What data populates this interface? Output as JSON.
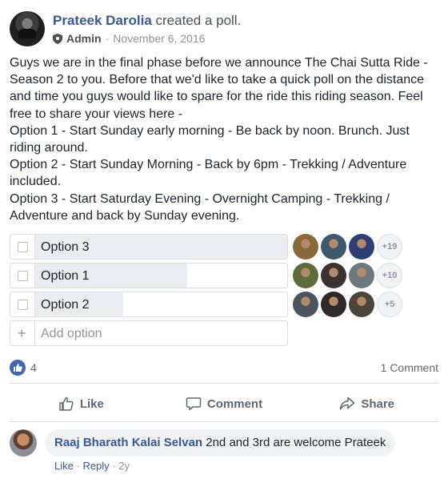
{
  "post": {
    "author": "Prateek Darolia",
    "action": " created a poll.",
    "role": "Admin",
    "date": "November 6, 2016",
    "text_lines": [
      "Guys we are in the final phase before we announce The Chai Sutta Ride -",
      "Season 2 to you. Before that we'd like to take a quick poll on the distance",
      "and time you guys would like to spare for the ride this riding season. Feel",
      "free to share your views here -",
      "Option 1 - Start Sunday early morning - Be back by noon. Brunch. Just",
      "riding around.",
      "Option 2 - Start Sunday Morning - Back by 6pm - Trekking / Adventure",
      "included.",
      "Option 3 - Start Saturday Evening - Overnight Camping - Trekking /",
      "Adventure and back by Sunday evening."
    ]
  },
  "poll": {
    "options": [
      {
        "label": "Option 3",
        "fill_fraction": 1.0,
        "more": "+19",
        "voter_colors": [
          "#8a6a3b",
          "#3b5a6e",
          "#2d3e73"
        ]
      },
      {
        "label": "Option 1",
        "fill_fraction": 0.6,
        "more": "+10",
        "voter_colors": [
          "#5e6b3a",
          "#3a3330",
          "#6c7a80"
        ]
      },
      {
        "label": "Option 2",
        "fill_fraction": 0.35,
        "more": "+5",
        "voter_colors": [
          "#4a5560",
          "#2f2a28",
          "#4d4438"
        ]
      }
    ],
    "add_option_label": "Add option",
    "add_icon": "+"
  },
  "stats": {
    "like_count": "4",
    "comment_count": "1 Comment"
  },
  "actions": {
    "like": "Like",
    "comment": "Comment",
    "share": "Share"
  },
  "comment": {
    "author": "Raaj Bharath Kalai Selvan",
    "text": " 2nd and 3rd are welcome Prateek",
    "like": "Like",
    "reply": "Reply",
    "age": "2y"
  },
  "colors": {
    "brand": "#385898",
    "like_blue": "#4267b2",
    "poll_fill": "#ebedf3"
  }
}
